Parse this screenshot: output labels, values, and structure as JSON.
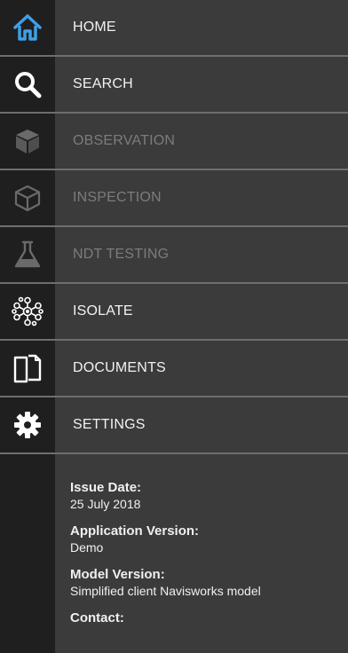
{
  "menu": {
    "items": [
      {
        "label": "HOME",
        "icon": "home-icon",
        "enabled": true
      },
      {
        "label": "SEARCH",
        "icon": "search-icon",
        "enabled": true
      },
      {
        "label": "OBSERVATION",
        "icon": "cube-solid-icon",
        "enabled": false
      },
      {
        "label": "INSPECTION",
        "icon": "cube-outline-icon",
        "enabled": false
      },
      {
        "label": "NDT TESTING",
        "icon": "flask-icon",
        "enabled": false
      },
      {
        "label": "ISOLATE",
        "icon": "network-icon",
        "enabled": true
      },
      {
        "label": "DOCUMENTS",
        "icon": "documents-icon",
        "enabled": true
      },
      {
        "label": "SETTINGS",
        "icon": "gear-icon",
        "enabled": true
      }
    ]
  },
  "info": {
    "issue_date_label": "Issue Date:",
    "issue_date_value": "25 July 2018",
    "app_version_label": "Application Version:",
    "app_version_value": "Demo",
    "model_version_label": "Model Version:",
    "model_version_value": "Simplified client Navisworks model",
    "contact_label": "Contact:"
  },
  "colors": {
    "home_icon": "#3f9fe6",
    "enabled_text": "#f2f2f2",
    "disabled_text": "#7c7c7c",
    "divider": "#6e6e6e",
    "rail": "#1f1f1f",
    "panel": "#3b3b3b"
  }
}
